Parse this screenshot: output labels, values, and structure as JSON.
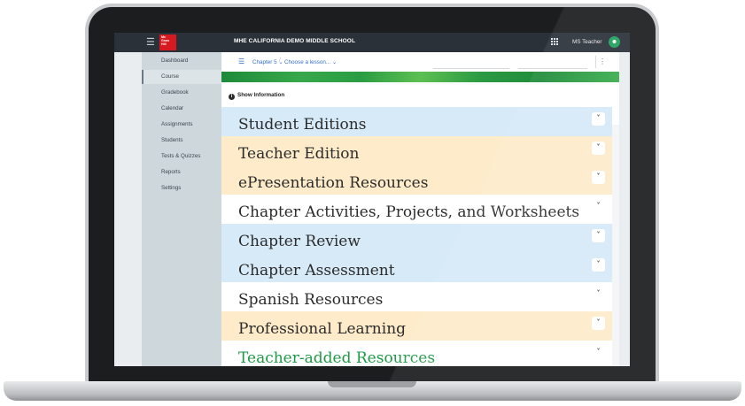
{
  "colors": {
    "topbar": "#2a3139",
    "sidebar": "#ced7dc",
    "blue_section": "#d6eaf8",
    "peach_section": "#fdebc9",
    "white_section": "#ffffff",
    "green_text": "#1e9a45",
    "link_blue": "#3670c4",
    "logo_red": "#d71920"
  },
  "header": {
    "menu_icon": "hamburger-icon",
    "logo_text": "Mc Graw Hill",
    "school_name": "MHE CALIFORNIA DEMO MIDDLE SCHOOL",
    "apps_icon": "grid-icon",
    "user_name": "MS Teacher",
    "avatar_icon": "user-avatar-icon"
  },
  "sidebar": {
    "items": [
      {
        "label": "Dashboard",
        "active": false
      },
      {
        "label": "Course",
        "active": true
      },
      {
        "label": "Gradebook",
        "active": false
      },
      {
        "label": "Calendar",
        "active": false
      },
      {
        "label": "Assignments",
        "active": false
      },
      {
        "label": "Students",
        "active": false
      },
      {
        "label": "Tests & Quizzes",
        "active": false
      },
      {
        "label": "Reports",
        "active": false
      },
      {
        "label": "Settings",
        "active": false
      }
    ]
  },
  "lesson_bar": {
    "chapter": "Chapter 5 ⌄",
    "lesson": "Choose a lesson... ⌄",
    "more_icon": "kebab-icon"
  },
  "show_information": "Show Information",
  "sections": [
    {
      "label": "Student Editions",
      "color": "#d6eaf8",
      "text_color": "#2c2c2c"
    },
    {
      "label": "Teacher Edition",
      "color": "#fdebc9",
      "text_color": "#2c2c2c"
    },
    {
      "label": "ePresentation Resources",
      "color": "#fdebc9",
      "text_color": "#2c2c2c"
    },
    {
      "label": "Chapter Activities, Projects, and Worksheets",
      "color": "#ffffff",
      "text_color": "#2c2c2c"
    },
    {
      "label": "Chapter Review",
      "color": "#d6eaf8",
      "text_color": "#2c2c2c"
    },
    {
      "label": "Chapter Assessment",
      "color": "#d6eaf8",
      "text_color": "#2c2c2c"
    },
    {
      "label": "Spanish Resources",
      "color": "#ffffff",
      "text_color": "#2c2c2c"
    },
    {
      "label": "Professional Learning",
      "color": "#fdebc9",
      "text_color": "#2c2c2c"
    },
    {
      "label": "Teacher-added Resources",
      "color": "#ffffff",
      "text_color": "#1e9a45"
    }
  ],
  "chevron": "˅"
}
